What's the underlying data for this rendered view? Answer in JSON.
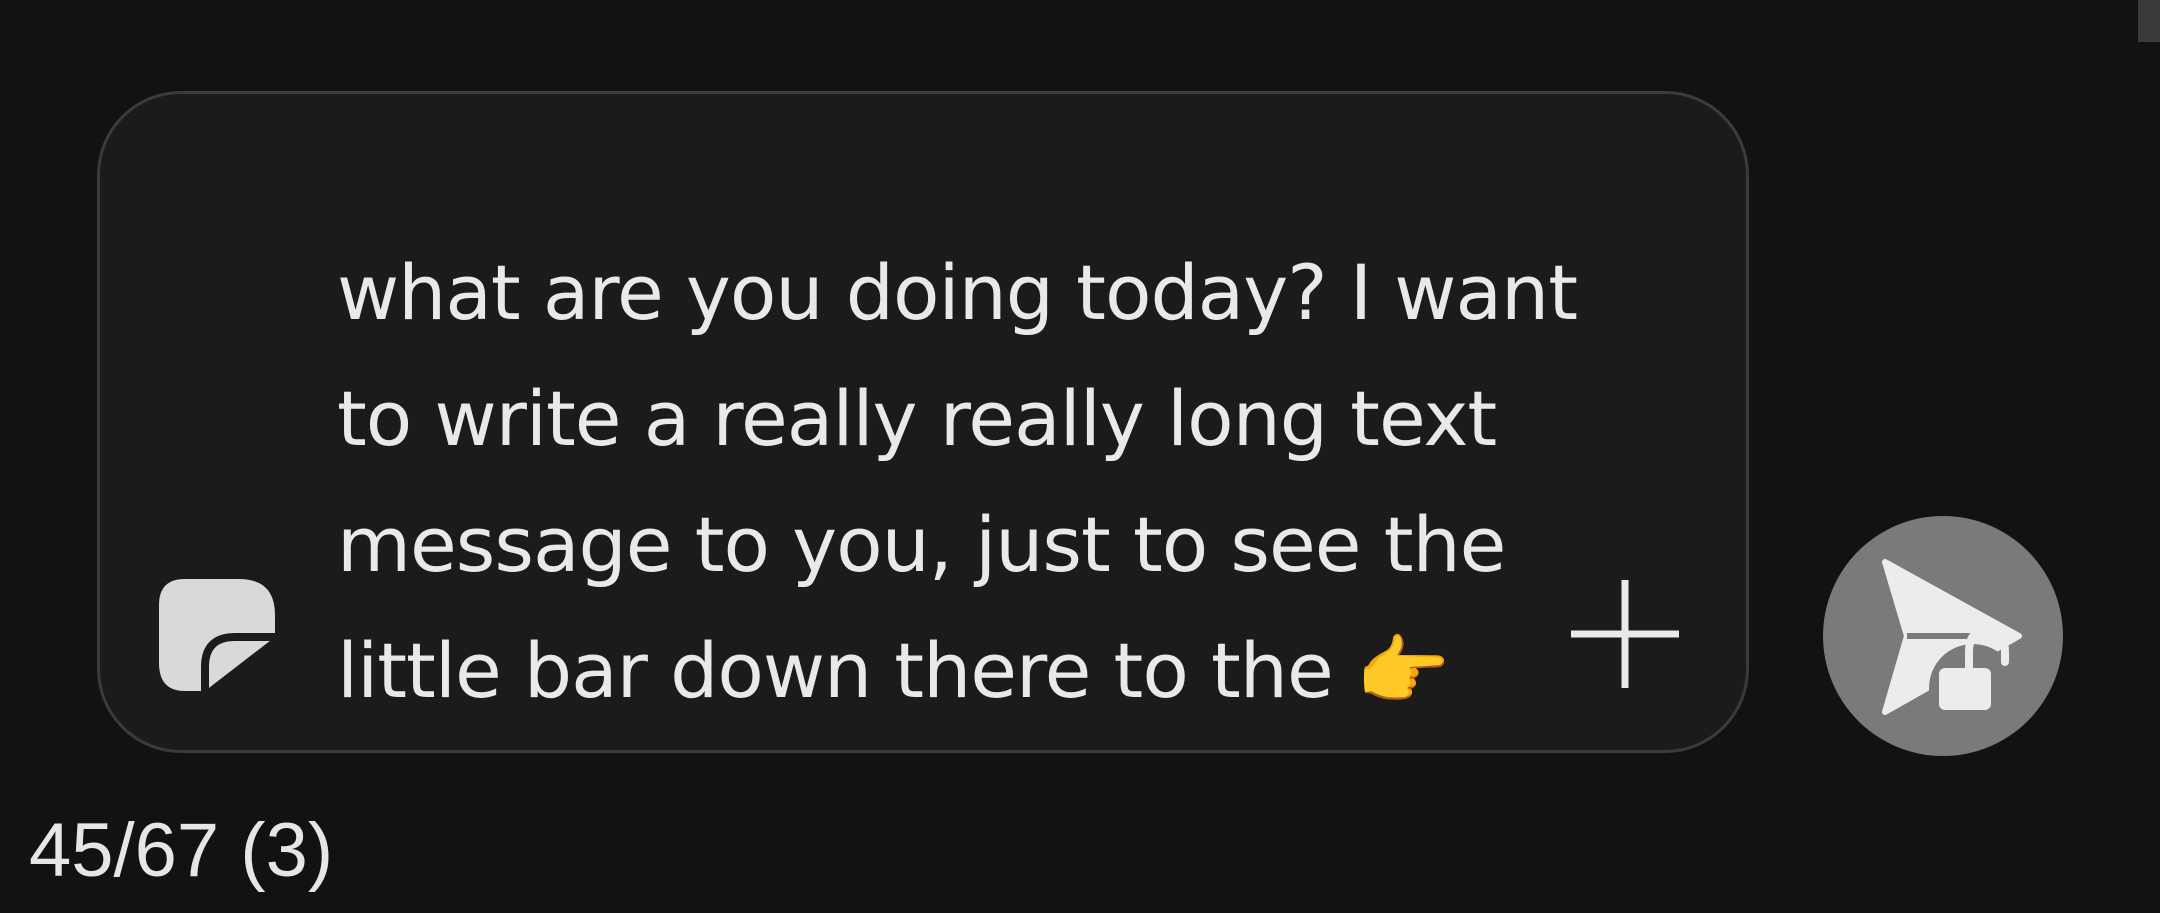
{
  "composer": {
    "message_text": "what are you doing today? I want to write a really really long text message to you, just to see the little bar down there to the 👉",
    "sticker_icon": "sticker-icon",
    "attach_icon": "plus-icon"
  },
  "send": {
    "icon": "send-icon",
    "badge_icon": "unlocked-padlock-icon"
  },
  "counter": {
    "text": "45/67 (3)"
  },
  "colors": {
    "background": "#121212",
    "composer_bg": "#1b1b1b",
    "composer_border": "#3b3b3b",
    "text": "#e9e9e9",
    "send_button_bg": "#7a7a7a",
    "icon_light": "#d9d9d9"
  }
}
